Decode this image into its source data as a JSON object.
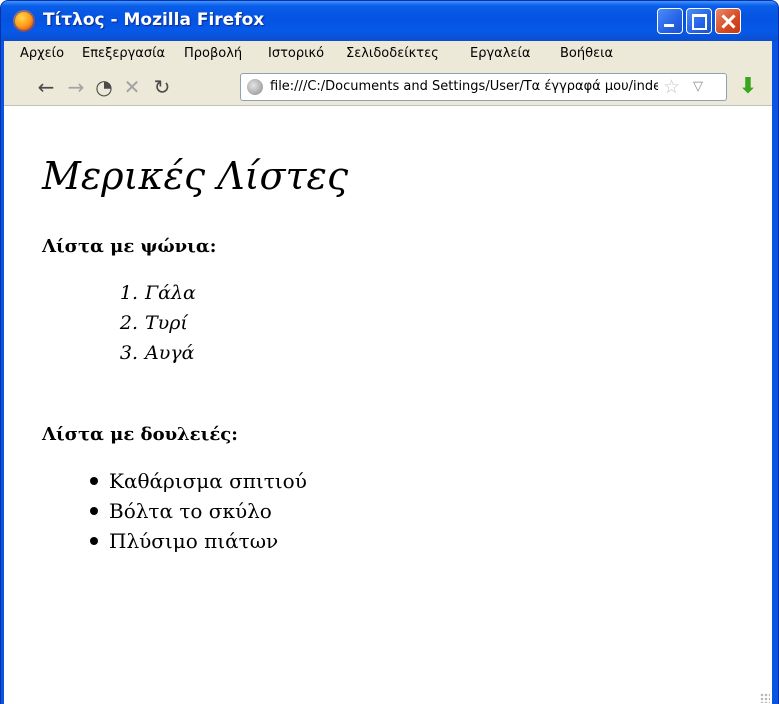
{
  "window": {
    "title": "Τίτλος - Mozilla Firefox"
  },
  "menu": {
    "items": [
      "Αρχείο",
      "Επεξεργασία",
      "Προβολή",
      "Ιστορικό",
      "Σελιδοδείκτες",
      "Εργαλεία",
      "Βοήθεια"
    ]
  },
  "navbar": {
    "url": "file:///C:/Documents and Settings/User/Τα έγγραφά μου/index.html",
    "icons": [
      "back-icon",
      "forward-icon",
      "history-icon",
      "stop-icon",
      "reload-icon",
      "site-identity-icon",
      "bookmark-star-icon",
      "url-dropdown-icon",
      "download-icon"
    ]
  },
  "page": {
    "heading": "Μερικές Λίστες",
    "shopping": {
      "heading": "Λίστα με ψώνια:",
      "items": [
        {
          "num": "1.",
          "text": "Γάλα"
        },
        {
          "num": "2.",
          "text": "Τυρί"
        },
        {
          "num": "3.",
          "text": "Αυγά"
        }
      ]
    },
    "chores": {
      "heading": "Λίστα με δουλειές:",
      "items": [
        "Καθάρισμα σπιτιού",
        "Βόλτα το σκύλο",
        "Πλύσιμο πιάτων"
      ]
    }
  },
  "colors": {
    "titlebar": "#0553e2",
    "chrome": "#ece9d8",
    "close_button": "#d64a22",
    "download_arrow": "#3ba51f"
  }
}
